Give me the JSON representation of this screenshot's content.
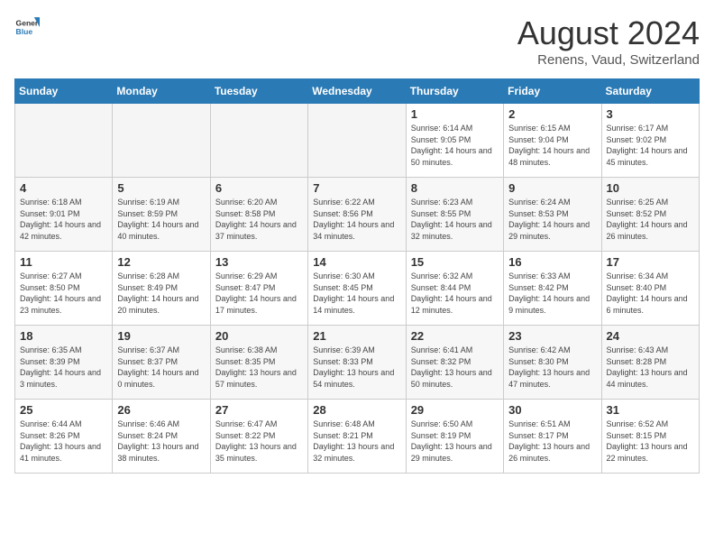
{
  "logo": {
    "line1": "General",
    "line2": "Blue"
  },
  "title": {
    "month_year": "August 2024",
    "location": "Renens, Vaud, Switzerland"
  },
  "weekdays": [
    "Sunday",
    "Monday",
    "Tuesday",
    "Wednesday",
    "Thursday",
    "Friday",
    "Saturday"
  ],
  "weeks": [
    [
      {
        "day": "",
        "empty": true
      },
      {
        "day": "",
        "empty": true
      },
      {
        "day": "",
        "empty": true
      },
      {
        "day": "",
        "empty": true
      },
      {
        "day": "1",
        "sunrise": "6:14 AM",
        "sunset": "9:05 PM",
        "daylight": "14 hours and 50 minutes."
      },
      {
        "day": "2",
        "sunrise": "6:15 AM",
        "sunset": "9:04 PM",
        "daylight": "14 hours and 48 minutes."
      },
      {
        "day": "3",
        "sunrise": "6:17 AM",
        "sunset": "9:02 PM",
        "daylight": "14 hours and 45 minutes."
      }
    ],
    [
      {
        "day": "4",
        "sunrise": "6:18 AM",
        "sunset": "9:01 PM",
        "daylight": "14 hours and 42 minutes."
      },
      {
        "day": "5",
        "sunrise": "6:19 AM",
        "sunset": "8:59 PM",
        "daylight": "14 hours and 40 minutes."
      },
      {
        "day": "6",
        "sunrise": "6:20 AM",
        "sunset": "8:58 PM",
        "daylight": "14 hours and 37 minutes."
      },
      {
        "day": "7",
        "sunrise": "6:22 AM",
        "sunset": "8:56 PM",
        "daylight": "14 hours and 34 minutes."
      },
      {
        "day": "8",
        "sunrise": "6:23 AM",
        "sunset": "8:55 PM",
        "daylight": "14 hours and 32 minutes."
      },
      {
        "day": "9",
        "sunrise": "6:24 AM",
        "sunset": "8:53 PM",
        "daylight": "14 hours and 29 minutes."
      },
      {
        "day": "10",
        "sunrise": "6:25 AM",
        "sunset": "8:52 PM",
        "daylight": "14 hours and 26 minutes."
      }
    ],
    [
      {
        "day": "11",
        "sunrise": "6:27 AM",
        "sunset": "8:50 PM",
        "daylight": "14 hours and 23 minutes."
      },
      {
        "day": "12",
        "sunrise": "6:28 AM",
        "sunset": "8:49 PM",
        "daylight": "14 hours and 20 minutes."
      },
      {
        "day": "13",
        "sunrise": "6:29 AM",
        "sunset": "8:47 PM",
        "daylight": "14 hours and 17 minutes."
      },
      {
        "day": "14",
        "sunrise": "6:30 AM",
        "sunset": "8:45 PM",
        "daylight": "14 hours and 14 minutes."
      },
      {
        "day": "15",
        "sunrise": "6:32 AM",
        "sunset": "8:44 PM",
        "daylight": "14 hours and 12 minutes."
      },
      {
        "day": "16",
        "sunrise": "6:33 AM",
        "sunset": "8:42 PM",
        "daylight": "14 hours and 9 minutes."
      },
      {
        "day": "17",
        "sunrise": "6:34 AM",
        "sunset": "8:40 PM",
        "daylight": "14 hours and 6 minutes."
      }
    ],
    [
      {
        "day": "18",
        "sunrise": "6:35 AM",
        "sunset": "8:39 PM",
        "daylight": "14 hours and 3 minutes."
      },
      {
        "day": "19",
        "sunrise": "6:37 AM",
        "sunset": "8:37 PM",
        "daylight": "14 hours and 0 minutes."
      },
      {
        "day": "20",
        "sunrise": "6:38 AM",
        "sunset": "8:35 PM",
        "daylight": "13 hours and 57 minutes."
      },
      {
        "day": "21",
        "sunrise": "6:39 AM",
        "sunset": "8:33 PM",
        "daylight": "13 hours and 54 minutes."
      },
      {
        "day": "22",
        "sunrise": "6:41 AM",
        "sunset": "8:32 PM",
        "daylight": "13 hours and 50 minutes."
      },
      {
        "day": "23",
        "sunrise": "6:42 AM",
        "sunset": "8:30 PM",
        "daylight": "13 hours and 47 minutes."
      },
      {
        "day": "24",
        "sunrise": "6:43 AM",
        "sunset": "8:28 PM",
        "daylight": "13 hours and 44 minutes."
      }
    ],
    [
      {
        "day": "25",
        "sunrise": "6:44 AM",
        "sunset": "8:26 PM",
        "daylight": "13 hours and 41 minutes."
      },
      {
        "day": "26",
        "sunrise": "6:46 AM",
        "sunset": "8:24 PM",
        "daylight": "13 hours and 38 minutes."
      },
      {
        "day": "27",
        "sunrise": "6:47 AM",
        "sunset": "8:22 PM",
        "daylight": "13 hours and 35 minutes."
      },
      {
        "day": "28",
        "sunrise": "6:48 AM",
        "sunset": "8:21 PM",
        "daylight": "13 hours and 32 minutes."
      },
      {
        "day": "29",
        "sunrise": "6:50 AM",
        "sunset": "8:19 PM",
        "daylight": "13 hours and 29 minutes."
      },
      {
        "day": "30",
        "sunrise": "6:51 AM",
        "sunset": "8:17 PM",
        "daylight": "13 hours and 26 minutes."
      },
      {
        "day": "31",
        "sunrise": "6:52 AM",
        "sunset": "8:15 PM",
        "daylight": "13 hours and 22 minutes."
      }
    ]
  ]
}
